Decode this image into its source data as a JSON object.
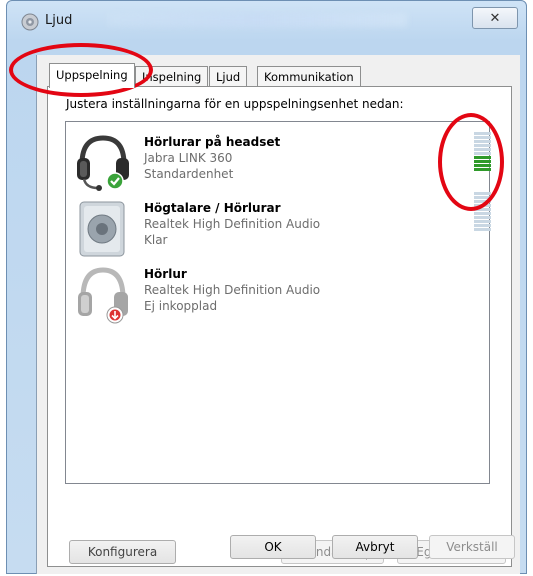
{
  "window": {
    "title": "Ljud",
    "close_glyph": "✕"
  },
  "tabs": [
    {
      "label": "Uppspelning",
      "active": true
    },
    {
      "label": "Inspelning",
      "active": false
    },
    {
      "label": "Ljud",
      "active": false
    },
    {
      "label": "Kommunikation",
      "active": false
    }
  ],
  "panel": {
    "instruction": "Justera inställningarna för en uppspelningsenhet nedan:"
  },
  "devices": [
    {
      "name": "Hörlurar på headset",
      "model": "Jabra LINK 360",
      "status": "Standardenhet",
      "icon": "headset-icon",
      "badge": "default-check-badge",
      "meter_level": 0.4
    },
    {
      "name": "Högtalare / Hörlurar",
      "model": "Realtek High Definition Audio",
      "status": "Klar",
      "icon": "speaker-icon",
      "meter_level": 0
    },
    {
      "name": "Hörlur",
      "model": "Realtek High Definition Audio",
      "status": "Ej inkopplad",
      "icon": "headphones-icon",
      "badge": "unplugged-badge"
    }
  ],
  "buttons": {
    "configure": "Konfigurera",
    "default": "Standard",
    "properties": "Egenskaper",
    "ok": "OK",
    "cancel": "Avbryt",
    "apply": "Verkställ"
  },
  "colors": {
    "annotation": "#e30613",
    "meter_on": "#2f9a2a",
    "meter_off": "#c9d7e3"
  }
}
